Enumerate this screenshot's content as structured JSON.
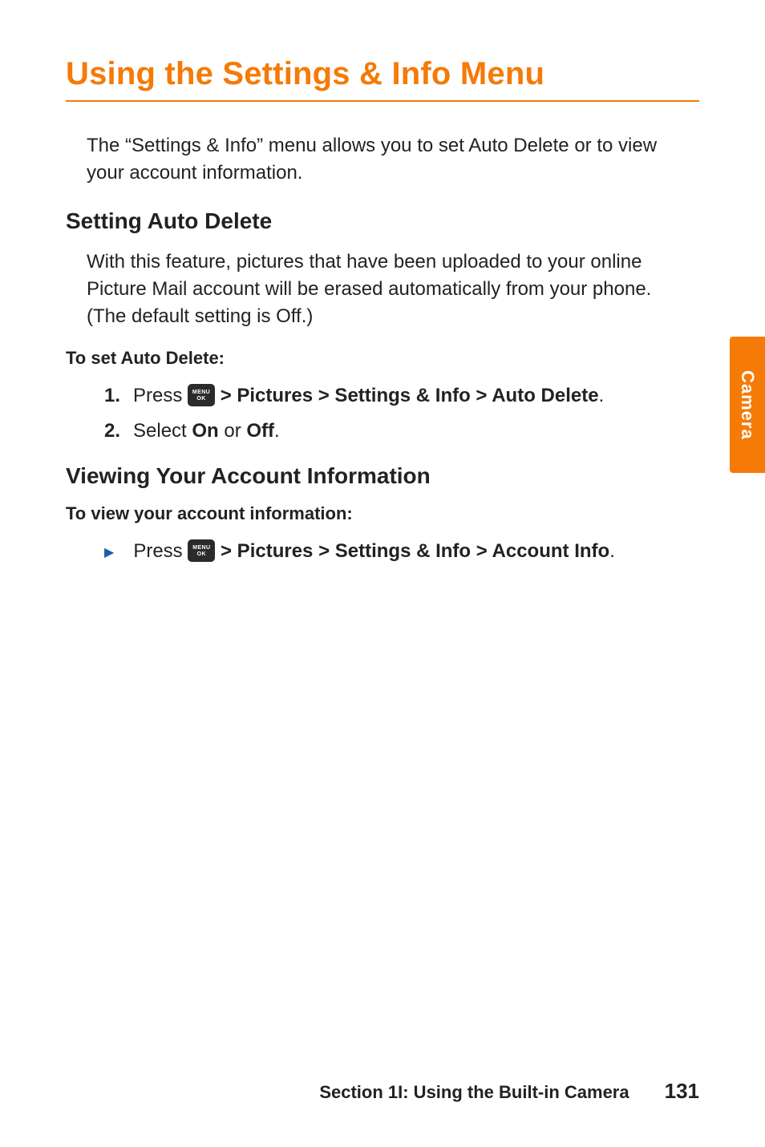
{
  "title": "Using the Settings & Info Menu",
  "intro": "The “Settings & Info” menu allows you to set Auto Delete or to view your account information.",
  "section1": {
    "heading": "Setting Auto Delete",
    "desc": "With this feature, pictures that have been uploaded to your online Picture Mail account will be erased automatically from your phone. (The default setting is Off.)",
    "subhead": "To set Auto Delete:",
    "steps": {
      "n1": "1.",
      "s1_press": "Press ",
      "s1_path": " > Pictures > Settings & Info > Auto Delete",
      "s1_end": ".",
      "n2": "2.",
      "s2_pre": "Select ",
      "s2_on": "On",
      "s2_or": " or ",
      "s2_off": "Off",
      "s2_end": "."
    }
  },
  "section2": {
    "heading": "Viewing Your Account Information",
    "subhead": "To view your account information:",
    "item": {
      "press": "Press ",
      "path": " > Pictures > Settings & Info > Account Info",
      "end": "."
    }
  },
  "key": {
    "top": "MENU",
    "bottom": "OK"
  },
  "sidetab": "Camera",
  "footer": {
    "section": "Section 1I: Using the Built-in Camera",
    "page": "131"
  }
}
